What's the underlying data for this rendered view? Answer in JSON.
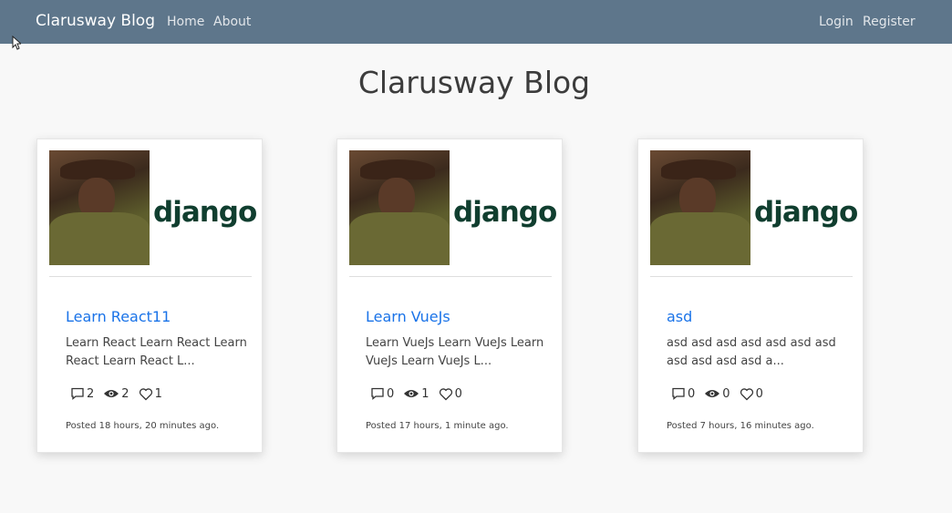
{
  "navbar": {
    "brand": "Clarusway Blog",
    "links": [
      "Home",
      "About"
    ],
    "auth": [
      "Login",
      "Register"
    ]
  },
  "page": {
    "title": "Clarusway Blog"
  },
  "posts": [
    {
      "title": "Learn React11",
      "excerpt": "Learn React Learn React Learn React Learn React L...",
      "comments": "2",
      "views": "2",
      "likes": "1",
      "posted": "Posted 18 hours, 20 minutes ago.",
      "image_text": "django"
    },
    {
      "title": "Learn VueJs",
      "excerpt": "Learn VueJs Learn VueJs Learn VueJs Learn VueJs L...",
      "comments": "0",
      "views": "1",
      "likes": "0",
      "posted": "Posted 17 hours, 1 minute ago.",
      "image_text": "django"
    },
    {
      "title": "asd",
      "excerpt": "asd asd asd asd asd asd asd asd asd asd asd a...",
      "comments": "0",
      "views": "0",
      "likes": "0",
      "posted": "Posted 7 hours, 16 minutes ago.",
      "image_text": "django"
    }
  ],
  "colors": {
    "navbar": "#5e768b",
    "link": "#1a73e8",
    "background": "#f8f8f8"
  },
  "icons": {
    "comment": "comment-icon",
    "views": "eye-icon",
    "likes": "heart-icon"
  }
}
